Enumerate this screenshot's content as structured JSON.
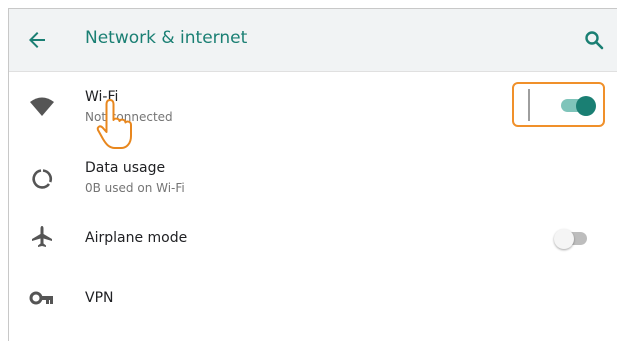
{
  "appbar": {
    "title": "Network & internet",
    "back_icon": "arrow-left-icon",
    "search_icon": "search-icon",
    "accent": "#1a7f73"
  },
  "items": [
    {
      "label": "Wi-Fi",
      "subtitle": "Not connected",
      "icon": "wifi-icon",
      "toggle": "on"
    },
    {
      "label": "Data usage",
      "subtitle": "0B used on Wi-Fi",
      "icon": "data-usage-icon"
    },
    {
      "label": "Airplane mode",
      "icon": "airplane-icon",
      "toggle": "off"
    },
    {
      "label": "VPN",
      "icon": "vpn-key-icon"
    }
  ],
  "colors": {
    "toggle_on_track": "#7fc4ba",
    "toggle_on_thumb": "#1a7f73",
    "toggle_off_track": "#bdbdbd",
    "toggle_off_thumb": "#f5f5f5",
    "highlight": "#f0902a"
  }
}
